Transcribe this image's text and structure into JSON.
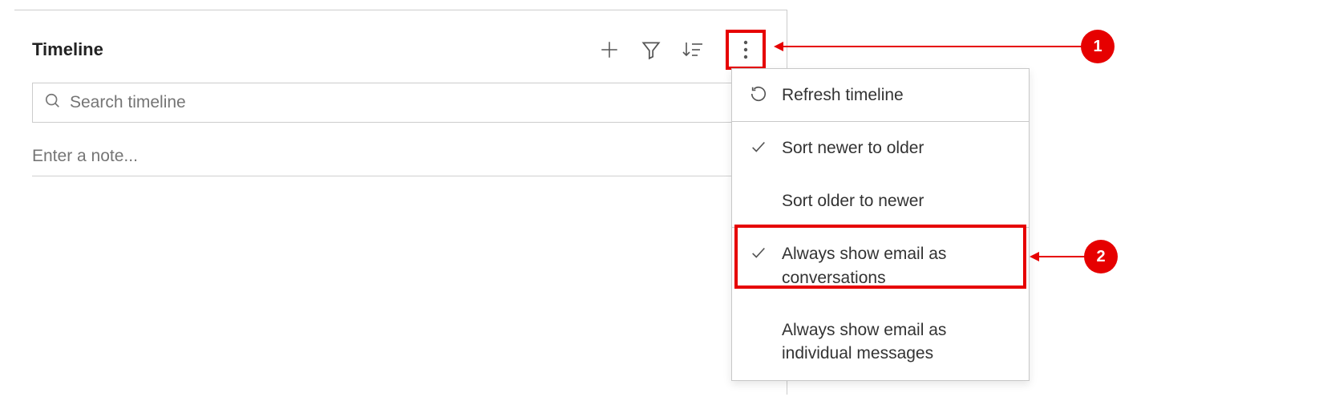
{
  "panel": {
    "title": "Timeline",
    "search_placeholder": "Search timeline",
    "note_placeholder": "Enter a note..."
  },
  "dropdown": {
    "refresh": "Refresh timeline",
    "sort_newer": "Sort newer to older",
    "sort_older": "Sort older to newer",
    "email_conversations": "Always show email as conversations",
    "email_individual": "Always show email as individual messages"
  },
  "callouts": {
    "c1": "1",
    "c2": "2"
  }
}
